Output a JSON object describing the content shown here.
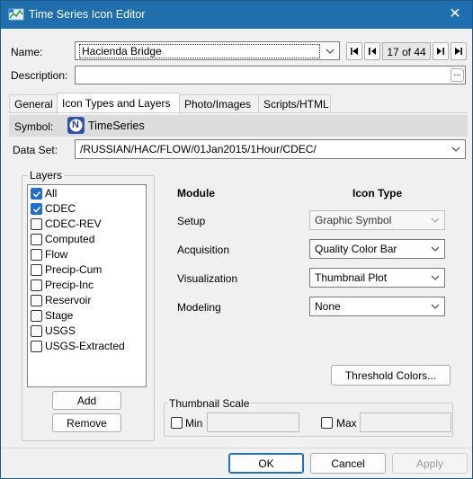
{
  "window": {
    "title": "Time Series Icon Editor"
  },
  "header": {
    "name_label": "Name:",
    "name_value": "Hacienda Bridge",
    "counter": "17 of 44",
    "description_label": "Description:",
    "description_value": "",
    "ellipsis_label": "..."
  },
  "tabs": [
    {
      "label": "General",
      "active": false
    },
    {
      "label": "Icon Types and Layers",
      "active": true
    },
    {
      "label": "Photo/Images",
      "active": false
    },
    {
      "label": "Scripts/HTML",
      "active": false
    }
  ],
  "symbol": {
    "label": "Symbol:",
    "icon_letter": "N",
    "value": "TimeSeries"
  },
  "dataset": {
    "label": "Data Set:",
    "value": "/RUSSIAN/HAC/FLOW/01Jan2015/1Hour/CDEC/"
  },
  "layers": {
    "title": "Layers",
    "items": [
      {
        "label": "All",
        "checked": true
      },
      {
        "label": "CDEC",
        "checked": true
      },
      {
        "label": "CDEC-REV",
        "checked": false
      },
      {
        "label": "Computed",
        "checked": false
      },
      {
        "label": "Flow",
        "checked": false
      },
      {
        "label": "Precip-Cum",
        "checked": false
      },
      {
        "label": "Precip-Inc",
        "checked": false
      },
      {
        "label": "Reservoir",
        "checked": false
      },
      {
        "label": "Stage",
        "checked": false
      },
      {
        "label": "USGS",
        "checked": false
      },
      {
        "label": "USGS-Extracted",
        "checked": false
      }
    ],
    "add_label": "Add",
    "remove_label": "Remove"
  },
  "modules": {
    "module_header": "Module",
    "icon_type_header": "Icon Type",
    "rows": [
      {
        "module": "Setup",
        "icon_type": "Graphic Symbol",
        "enabled": false
      },
      {
        "module": "Acquisition",
        "icon_type": "Quality Color Bar",
        "enabled": true
      },
      {
        "module": "Visualization",
        "icon_type": "Thumbnail Plot",
        "enabled": true
      },
      {
        "module": "Modeling",
        "icon_type": "None",
        "enabled": true
      }
    ]
  },
  "threshold": {
    "label": "Threshold Colors..."
  },
  "thumbnail": {
    "title": "Thumbnail Scale",
    "min_label": "Min",
    "max_label": "Max"
  },
  "footer": {
    "ok_label": "OK",
    "cancel_label": "Cancel",
    "apply_label": "Apply"
  },
  "colors": {
    "titlebar": "#1f6fae",
    "accent": "#1f6fcc"
  }
}
